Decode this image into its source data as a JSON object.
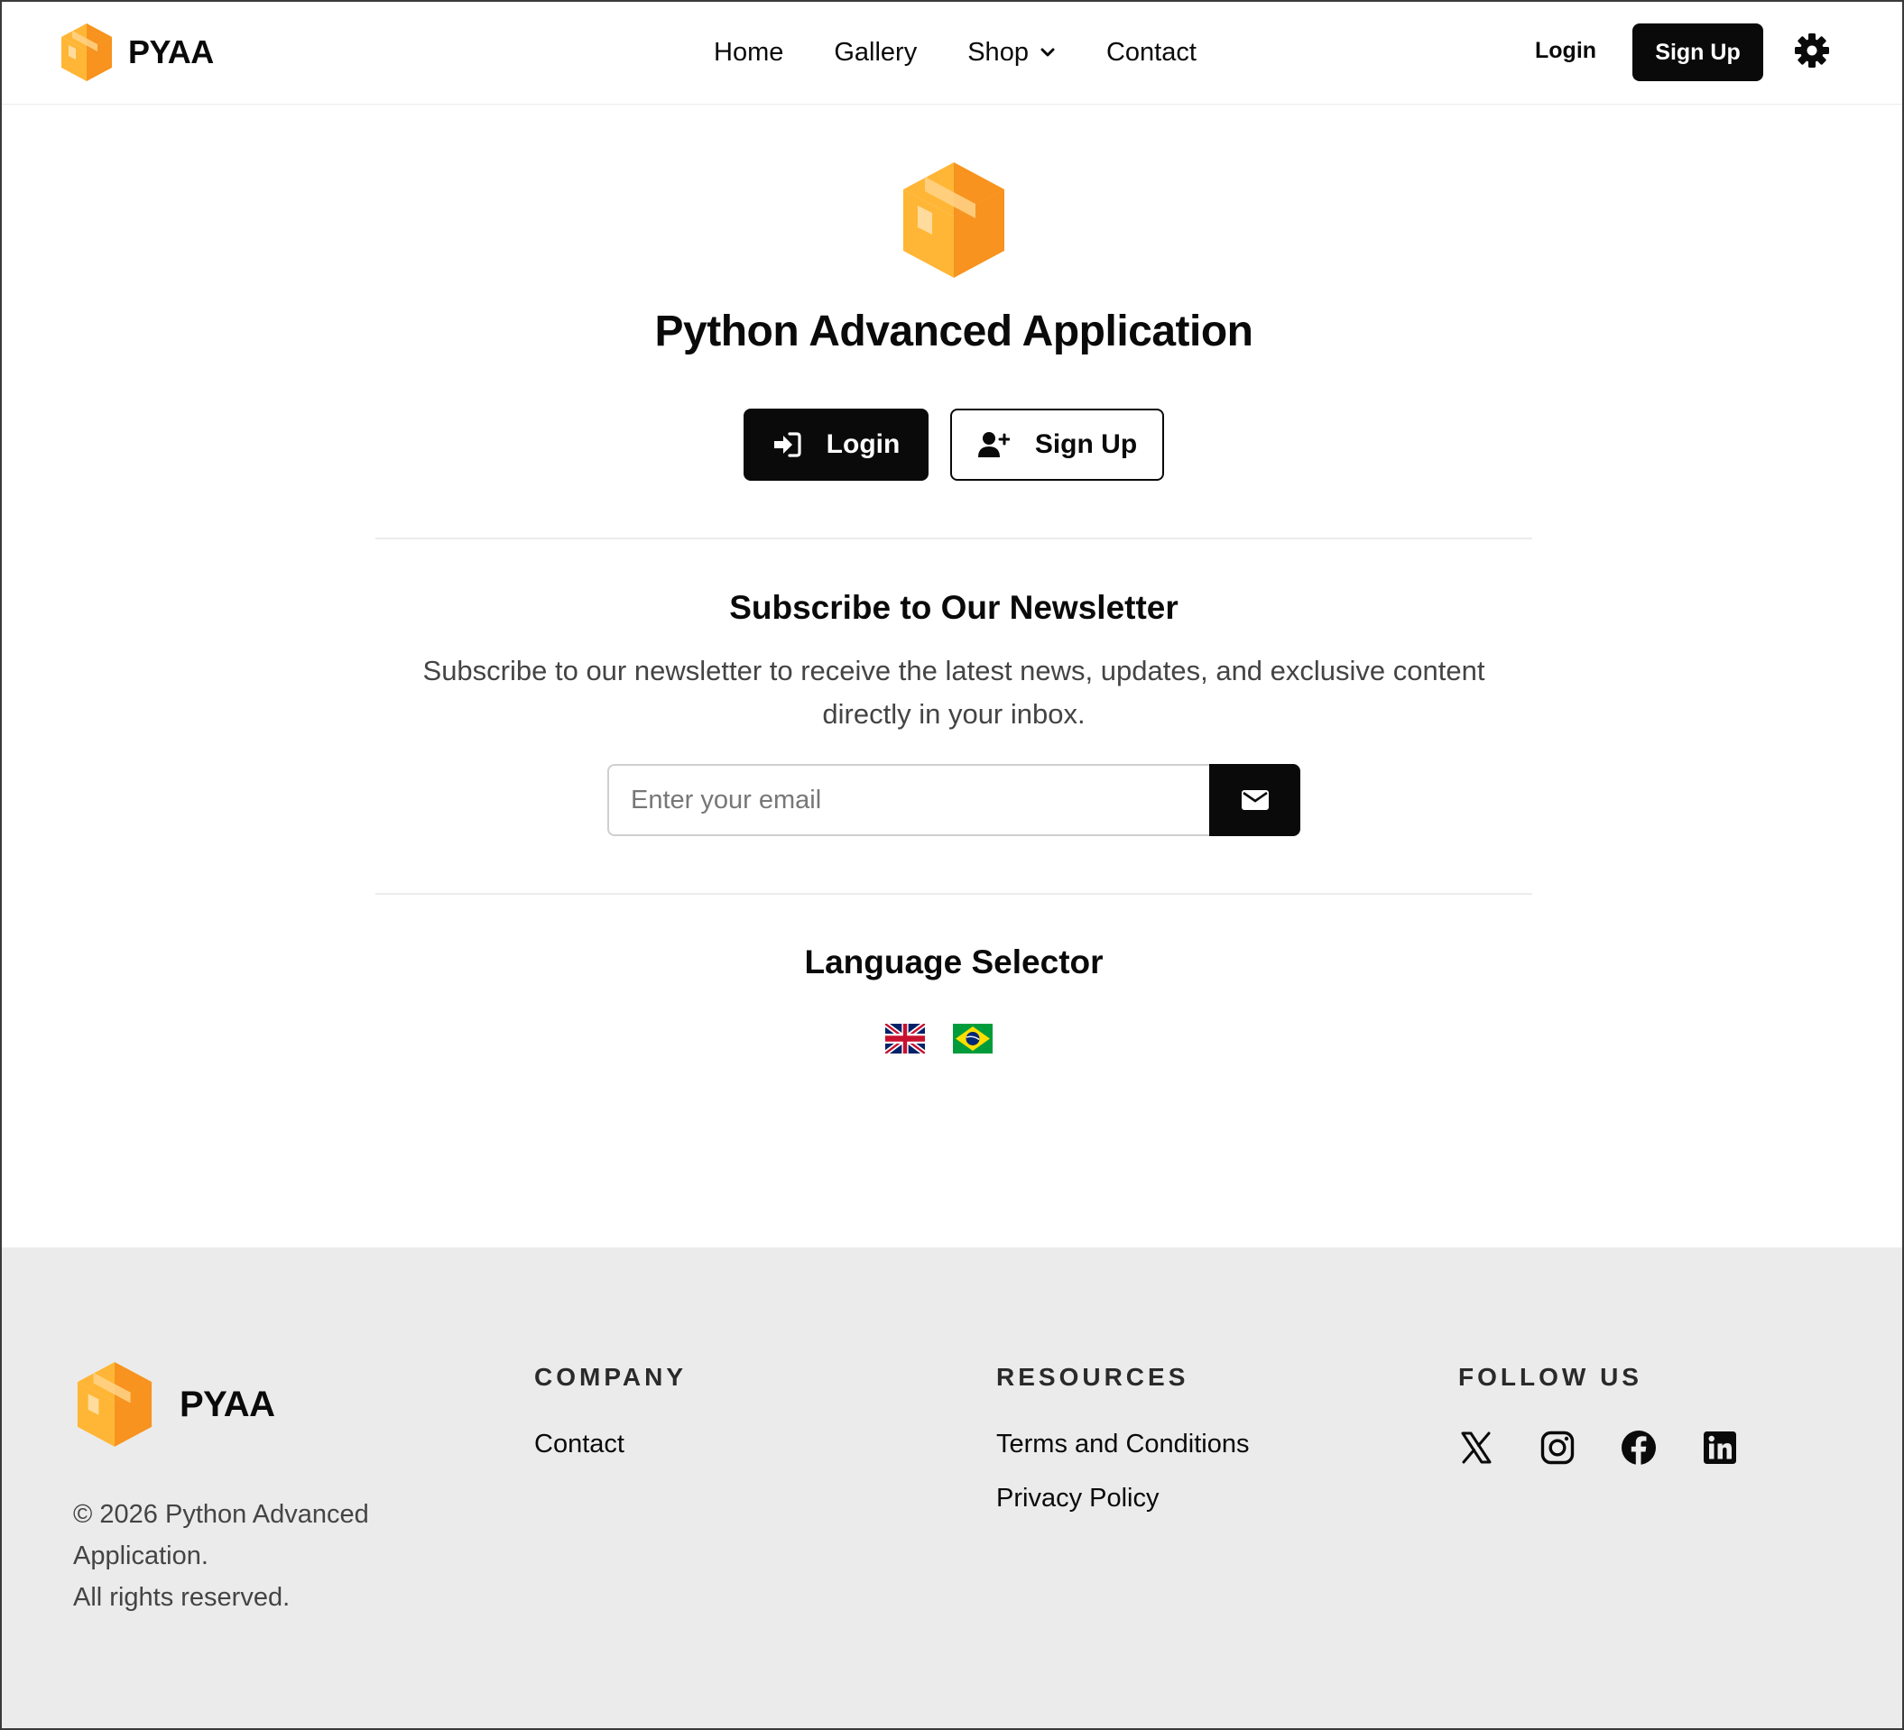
{
  "brand": {
    "name": "PYAA"
  },
  "nav": {
    "links": [
      "Home",
      "Gallery",
      "Shop",
      "Contact"
    ],
    "login_label": "Login",
    "signup_label": "Sign Up"
  },
  "hero": {
    "title": "Python Advanced Application",
    "login_label": "Login",
    "signup_label": "Sign Up"
  },
  "newsletter": {
    "title": "Subscribe to Our Newsletter",
    "description": "Subscribe to our newsletter to receive the latest news, updates, and exclusive content directly in your inbox.",
    "email_placeholder": "Enter your email",
    "email_value": ""
  },
  "language": {
    "title": "Language Selector",
    "flags": [
      "uk-flag-icon",
      "brazil-flag-icon"
    ]
  },
  "footer": {
    "brand_name": "PYAA",
    "copyright_line1": "© 2026 Python Advanced Application.",
    "copyright_line2": "All rights reserved.",
    "company": {
      "heading": "COMPANY",
      "links": [
        "Contact"
      ]
    },
    "resources": {
      "heading": "RESOURCES",
      "links": [
        "Terms and Conditions",
        "Privacy Policy"
      ]
    },
    "follow": {
      "heading": "FOLLOW US",
      "icons": [
        "x-twitter-icon",
        "instagram-icon",
        "facebook-icon",
        "linkedin-icon"
      ]
    }
  },
  "colors": {
    "primary": "#0a0a0a",
    "footer_bg": "#ebebeb",
    "logo_orange": "#f7931e",
    "logo_yellow": "#ffb636",
    "muted_text": "#444444"
  }
}
